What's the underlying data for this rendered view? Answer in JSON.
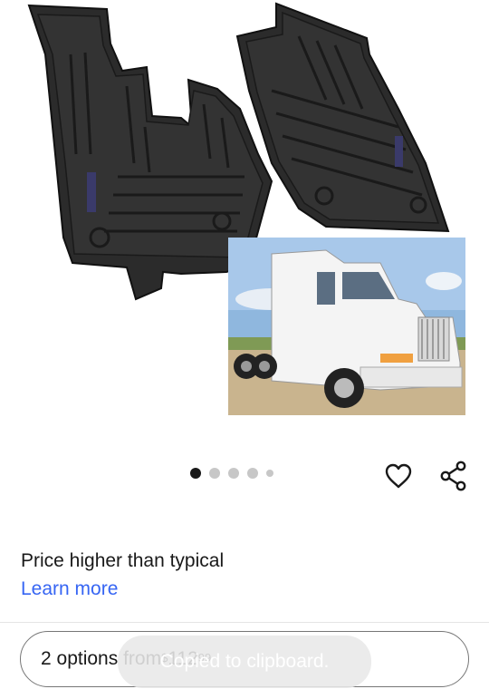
{
  "image_carousel": {
    "dots": [
      {
        "state": "active"
      },
      {
        "state": "normal"
      },
      {
        "state": "normal"
      },
      {
        "state": "normal"
      },
      {
        "state": "small"
      }
    ]
  },
  "actions": {
    "watch_icon": "heart-icon",
    "share_icon": "share-icon"
  },
  "pricing": {
    "note": "Price higher than typical",
    "link": "Learn more"
  },
  "options": {
    "text": "2 options from ",
    "currency": "$",
    "price_whole": "112",
    "price_cents": "99"
  },
  "toast": {
    "message": "Copied to clipboard."
  },
  "colors": {
    "link": "#3665f3",
    "text": "#191919",
    "dot_inactive": "#c7c7c7"
  }
}
